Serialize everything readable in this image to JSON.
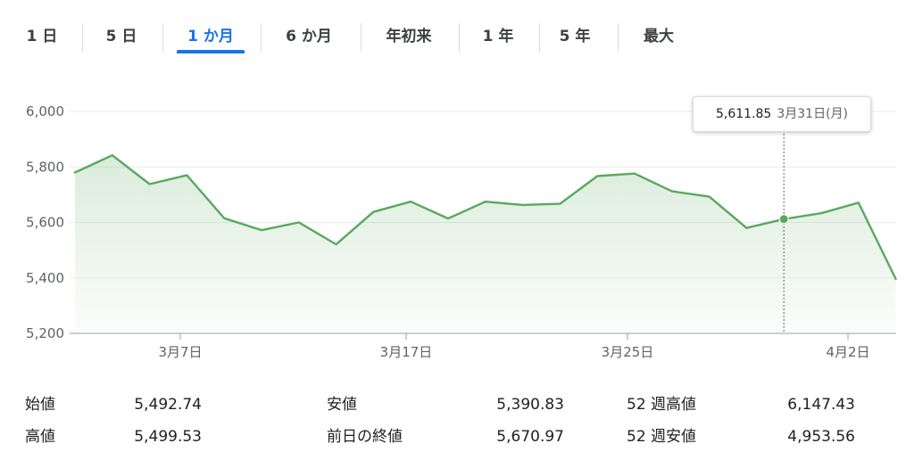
{
  "tabs": [
    {
      "label": "1 日",
      "active": false
    },
    {
      "label": "5 日",
      "active": false
    },
    {
      "label": "1 か月",
      "active": true
    },
    {
      "label": "6 か月",
      "active": false
    },
    {
      "label": "年初来",
      "active": false
    },
    {
      "label": "1 年",
      "active": false
    },
    {
      "label": "5 年",
      "active": false
    },
    {
      "label": "最大",
      "active": false
    }
  ],
  "tooltip": {
    "value": "5,611.85",
    "date": "3月31日(月)"
  },
  "stats": [
    {
      "label": "始値",
      "value": "5,492.74"
    },
    {
      "label": "高値",
      "value": "5,499.53"
    },
    {
      "label": "安値",
      "value": "5,390.83"
    },
    {
      "label": "前日の終値",
      "value": "5,670.97"
    },
    {
      "label": "52 週高値",
      "value": "6,147.43"
    },
    {
      "label": "52 週安値",
      "value": "4,953.56"
    }
  ],
  "colors": {
    "line": "#5aa85d",
    "fill": "#5aa85d",
    "grid": "#ebebeb",
    "axis": "#9aa0a6",
    "tick_text": "#5f6368",
    "active_tab": "#1a73e8"
  },
  "chart_data": {
    "type": "area",
    "x": [
      "2025-03-03",
      "2025-03-04",
      "2025-03-05",
      "2025-03-06",
      "2025-03-07",
      "2025-03-10",
      "2025-03-11",
      "2025-03-12",
      "2025-03-13",
      "2025-03-14",
      "2025-03-17",
      "2025-03-18",
      "2025-03-19",
      "2025-03-20",
      "2025-03-21",
      "2025-03-24",
      "2025-03-25",
      "2025-03-26",
      "2025-03-27",
      "2025-03-28",
      "2025-03-31",
      "2025-04-01",
      "2025-04-02",
      "2025-04-03"
    ],
    "values": [
      5780,
      5842,
      5738,
      5770,
      5615,
      5572,
      5600,
      5521,
      5638,
      5675,
      5614,
      5675,
      5663,
      5667,
      5767,
      5776,
      5712,
      5693,
      5580,
      5611.85,
      5633,
      5671,
      5396
    ],
    "x_ticks": [
      {
        "date": "2025-03-07",
        "label": "3月7日"
      },
      {
        "date": "2025-03-17",
        "label": "3月17日"
      },
      {
        "date": "2025-03-25",
        "label": "3月25日"
      },
      {
        "date": "2025-04-02",
        "label": "4月2日"
      }
    ],
    "y_ticks": [
      {
        "value": 6000,
        "label": "6,000"
      },
      {
        "value": 5800,
        "label": "5,800"
      },
      {
        "value": 5600,
        "label": "5,600"
      },
      {
        "value": 5400,
        "label": "5,400"
      },
      {
        "value": 5200,
        "label": "5,200"
      }
    ],
    "ylim": [
      5200,
      6000
    ],
    "highlight": {
      "date": "2025-03-31",
      "value": 5611.85
    },
    "grid": true
  }
}
